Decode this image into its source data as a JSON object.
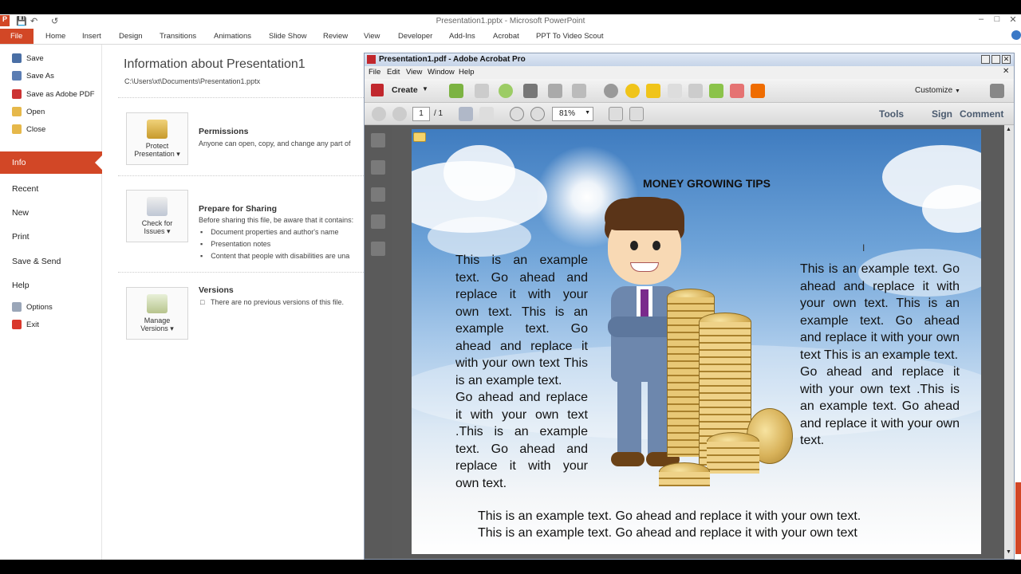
{
  "ppt": {
    "window_title": "Presentation1.pptx - Microsoft PowerPoint",
    "tabs": [
      "File",
      "Home",
      "Insert",
      "Design",
      "Transitions",
      "Animations",
      "Slide Show",
      "Review",
      "View",
      "Developer",
      "Add-Ins",
      "Acrobat",
      "PPT To Video Scout"
    ],
    "sidebar": {
      "small_items": [
        "Save",
        "Save As",
        "Save as Adobe PDF",
        "Open",
        "Close"
      ],
      "selected": "Info",
      "items": [
        "Recent",
        "New",
        "Print",
        "Save & Send",
        "Help"
      ],
      "bottom_items": [
        "Options",
        "Exit"
      ]
    },
    "info": {
      "heading": "Information about Presentation1",
      "path": "C:\\Users\\xt\\Documents\\Presentation1.pptx",
      "permissions": {
        "button": [
          "Protect",
          "Presentation ▾"
        ],
        "title": "Permissions",
        "text": "Anyone can open, copy, and change any part of"
      },
      "sharing": {
        "button": [
          "Check for",
          "Issues ▾"
        ],
        "title": "Prepare for Sharing",
        "text": "Before sharing this file, be aware that it contains:",
        "bullets": [
          "Document properties and author's name",
          "Presentation notes",
          "Content that people with disabilities are una"
        ]
      },
      "versions": {
        "button": [
          "Manage",
          "Versions ▾"
        ],
        "title": "Versions",
        "text": "There are no previous versions of this file."
      }
    }
  },
  "acrobat": {
    "window_title": "Presentation1.pdf - Adobe Acrobat Pro",
    "menu": [
      "File",
      "Edit",
      "View",
      "Window",
      "Help"
    ],
    "create_label": "Create",
    "customize_label": "Customize",
    "page_current": "1",
    "page_total": "/ 1",
    "zoom": "81%",
    "panes": [
      "Tools",
      "Sign",
      "Comment"
    ]
  },
  "slide": {
    "title": "MONEY GROWING TIPS",
    "left_text": "This is an example text. Go ahead and replace it with your own text. This is an example text. Go ahead and replace it with your own text This is an example text.",
    "left_text2": "Go ahead and replace it with your own text .This is an example text. Go ahead and replace it with your own text.",
    "right_text": "This is an example text. Go ahead and replace it with your own text. This is an example text. Go ahead and replace it with your own text This is an example text.",
    "right_text2": "Go ahead and replace it with your own text .This is an example text. Go ahead and replace it with your own text.",
    "bottom_line1": "This is an example text. Go ahead and replace it with your own text.",
    "bottom_line2": "This is an example text. Go ahead and replace it with your own text"
  },
  "colors": {
    "file_tab": "#d24726",
    "acrobat_title": "#c6d4e8",
    "sky_top": "#3f7cc0"
  }
}
